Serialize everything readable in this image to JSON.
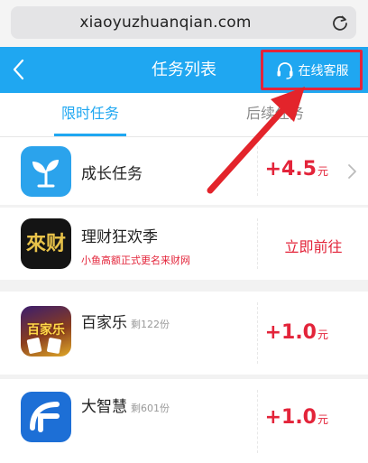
{
  "browser": {
    "url": "xiaoyuzhuanqian.com",
    "reload_icon": "reload-icon"
  },
  "header": {
    "title": "任务列表",
    "back_icon": "chevron-left-icon",
    "service_label": "在线客服",
    "service_icon": "headset-icon",
    "accent": "#1fa7f1",
    "highlight_color": "#e3243a"
  },
  "tabs": [
    {
      "label": "限时任务",
      "active": true
    },
    {
      "label": "后续任务",
      "active": false
    }
  ],
  "tasks": [
    {
      "name": "成长任务",
      "reward": "+4.5",
      "unit": "元",
      "icon": "sprout-icon"
    },
    {
      "name": "理财狂欢季",
      "subtitle": "小鱼高额正式更名来财网",
      "action": "立即前往",
      "icon": "laicai-logo-icon",
      "icon_text": "來财"
    },
    {
      "name": "百家乐",
      "remaining": "剩122份",
      "reward": "+1.0",
      "unit": "元",
      "icon": "baijiale-icon",
      "icon_text": "百家乐"
    },
    {
      "name": "大智慧",
      "remaining": "剩601份",
      "reward": "+1.0",
      "unit": "元",
      "icon": "dazhihui-logo-icon"
    }
  ]
}
